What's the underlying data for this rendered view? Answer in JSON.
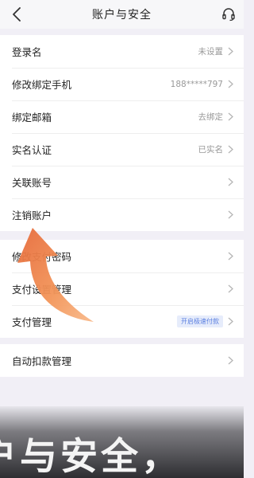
{
  "header": {
    "title": "账户与安全",
    "back_icon": "back-chevron-icon",
    "support_icon": "headset-icon"
  },
  "groups": [
    {
      "rows": [
        {
          "label": "登录名",
          "value": "未设置"
        },
        {
          "label": "修改绑定手机",
          "value": "188*****797"
        },
        {
          "label": "绑定邮箱",
          "value": "去绑定"
        },
        {
          "label": "实名认证",
          "value": "已实名"
        },
        {
          "label": "关联账号",
          "value": ""
        },
        {
          "label": "注销账户",
          "value": ""
        }
      ]
    },
    {
      "rows": [
        {
          "label": "修改支付密码",
          "value": ""
        },
        {
          "label": "支付设置管理",
          "value": ""
        },
        {
          "label": "支付管理",
          "badge": "开启极速付款"
        }
      ]
    },
    {
      "rows": [
        {
          "label": "自动扣款管理",
          "value": ""
        }
      ]
    }
  ],
  "overlay": {
    "caption": "户与安全，",
    "arrow_icon": "orange-curved-arrow-icon"
  },
  "colors": {
    "background": "#f1eff6",
    "row_background": "#ffffff",
    "value_text": "#999999",
    "badge_text": "#5b7fe0",
    "badge_background": "#e6ecfb",
    "arrow_orange": "#f08a4b"
  }
}
